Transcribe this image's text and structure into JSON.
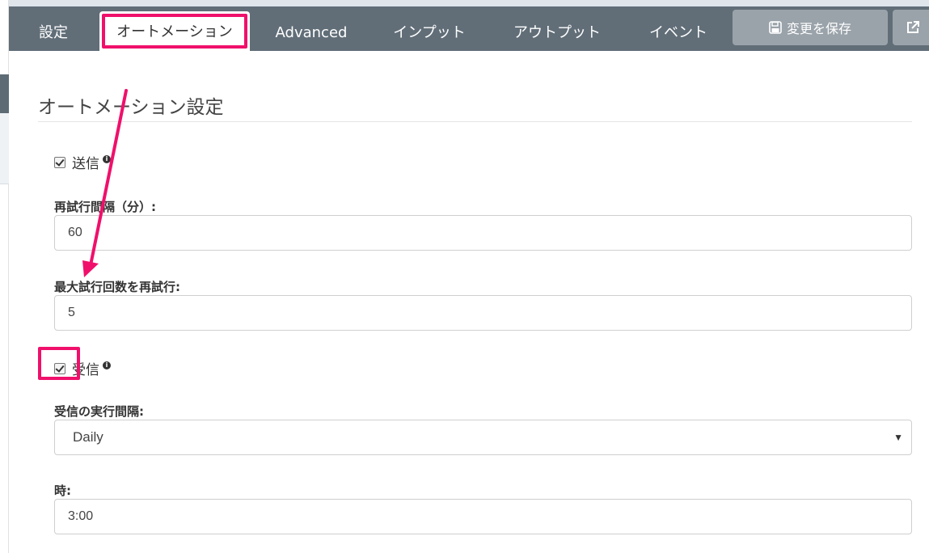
{
  "tabs": [
    {
      "label": "設定"
    },
    {
      "label": "オートメーション"
    },
    {
      "label": "Advanced"
    },
    {
      "label": "インプット"
    },
    {
      "label": "アウトプット"
    },
    {
      "label": "イベント"
    }
  ],
  "toolbar": {
    "save_label": "変更を保存"
  },
  "section": {
    "title": "オートメーション設定"
  },
  "send": {
    "label": "送信",
    "checked": true
  },
  "retry_interval": {
    "label": "再試行間隔（分）:",
    "value": "60"
  },
  "max_retries": {
    "label": "最大試行回数を再試行:",
    "value": "5"
  },
  "receive": {
    "label": "受信",
    "checked": true
  },
  "receive_interval": {
    "label": "受信の実行間隔:",
    "selected": "Daily"
  },
  "time": {
    "label": "時:",
    "value": "3:00"
  },
  "colors": {
    "highlight": "#f0106b",
    "topbar": "#616e78",
    "button": "#9aa3aa"
  },
  "icons": [
    "floppy-icon",
    "external-link-icon",
    "info-icon",
    "chevron-down-icon"
  ]
}
